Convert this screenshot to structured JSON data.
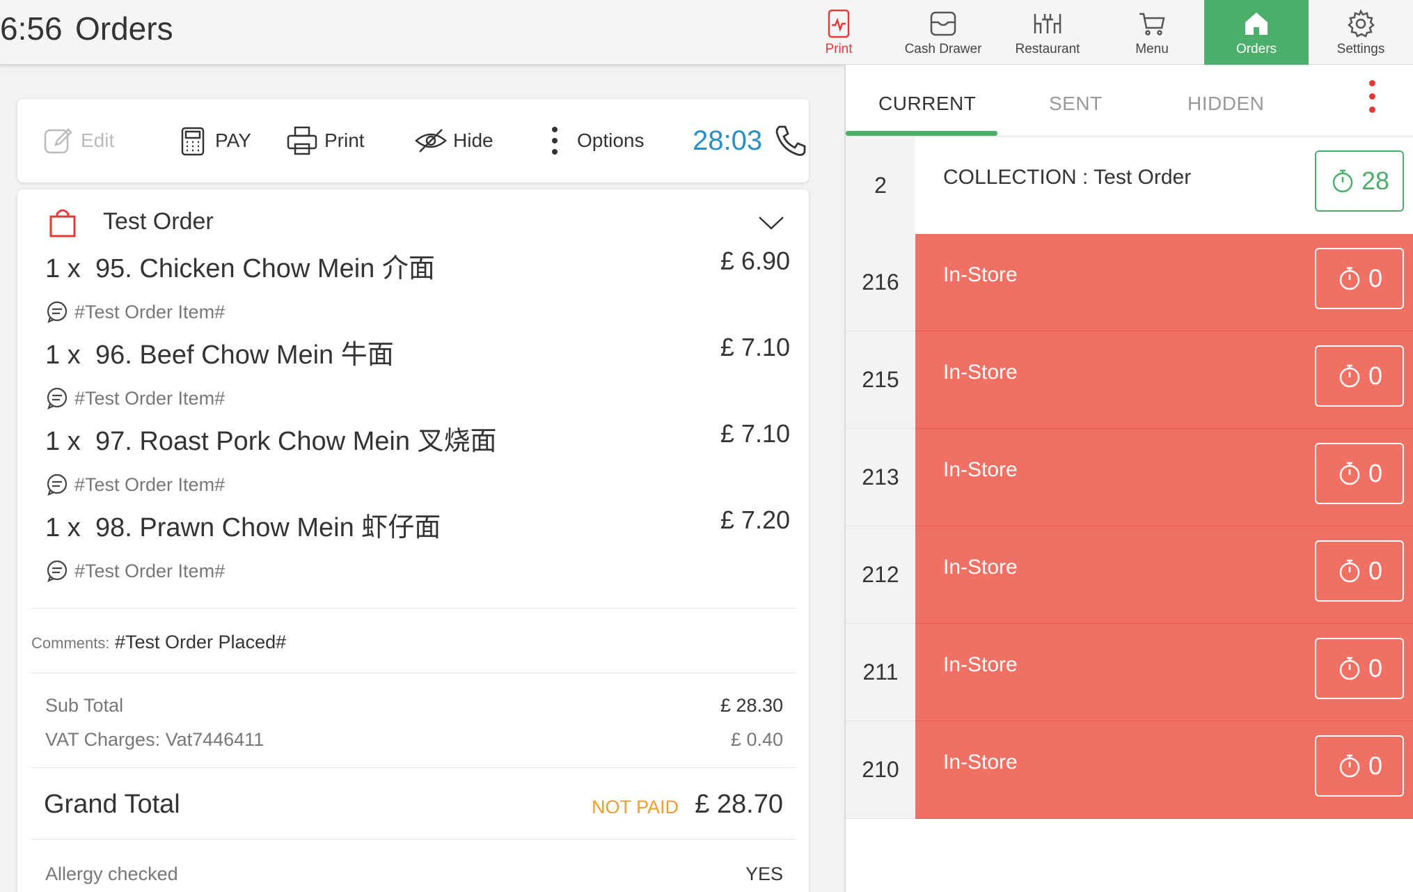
{
  "header": {
    "clock": "6:56",
    "title": "Orders",
    "nav": [
      {
        "label": "Print",
        "icon": "print-receipt-icon"
      },
      {
        "label": "Cash Drawer",
        "icon": "cash-drawer-icon"
      },
      {
        "label": "Restaurant",
        "icon": "restaurant-icon"
      },
      {
        "label": "Menu",
        "icon": "cart-icon"
      },
      {
        "label": "Orders",
        "icon": "home-icon"
      },
      {
        "label": "Settings",
        "icon": "gear-icon"
      }
    ]
  },
  "toolbar": {
    "edit": "Edit",
    "pay": "PAY",
    "print": "Print",
    "hide": "Hide",
    "options": "Options",
    "timer": "28:03"
  },
  "order": {
    "name": "Test Order",
    "items": [
      {
        "qty": "1 x",
        "name": "95. Chicken Chow Mein 介面",
        "price": "£ 6.90",
        "note": "#Test Order Item#"
      },
      {
        "qty": "1 x",
        "name": "96. Beef Chow Mein 牛面",
        "price": "£ 7.10",
        "note": "#Test Order Item#"
      },
      {
        "qty": "1 x",
        "name": "97. Roast Pork Chow Mein 叉烧面",
        "price": "£ 7.10",
        "note": "#Test Order Item#"
      },
      {
        "qty": "1 x",
        "name": "98. Prawn Chow Mein 虾仔面",
        "price": "£ 7.20",
        "note": "#Test Order Item#"
      }
    ],
    "comments_label": "Comments:",
    "comments": "#Test Order Placed#",
    "sub_total_label": "Sub Total",
    "sub_total": "£ 28.30",
    "vat_label": "VAT Charges: Vat7446411",
    "vat": "£ 0.40",
    "grand_total_label": "Grand Total",
    "payment_status": "NOT PAID",
    "grand_total": "£ 28.70",
    "allergy_label": "Allergy checked",
    "allergy_value": "YES"
  },
  "tabs": {
    "current": "CURRENT",
    "sent": "SENT",
    "hidden": "HIDDEN"
  },
  "order_list": [
    {
      "number": "2",
      "label": "COLLECTION : Test Order",
      "timer": "28"
    },
    {
      "number": "216",
      "label": "In-Store",
      "timer": "0"
    },
    {
      "number": "215",
      "label": "In-Store",
      "timer": "0"
    },
    {
      "number": "213",
      "label": "In-Store",
      "timer": "0"
    },
    {
      "number": "212",
      "label": "In-Store",
      "timer": "0"
    },
    {
      "number": "211",
      "label": "In-Store",
      "timer": "0"
    },
    {
      "number": "210",
      "label": "In-Store",
      "timer": "0"
    }
  ],
  "colors": {
    "accent_green": "#4cae6b",
    "alert_red": "#f07164",
    "timer_blue": "#2a8fc7",
    "not_paid_orange": "#f39c2c"
  }
}
